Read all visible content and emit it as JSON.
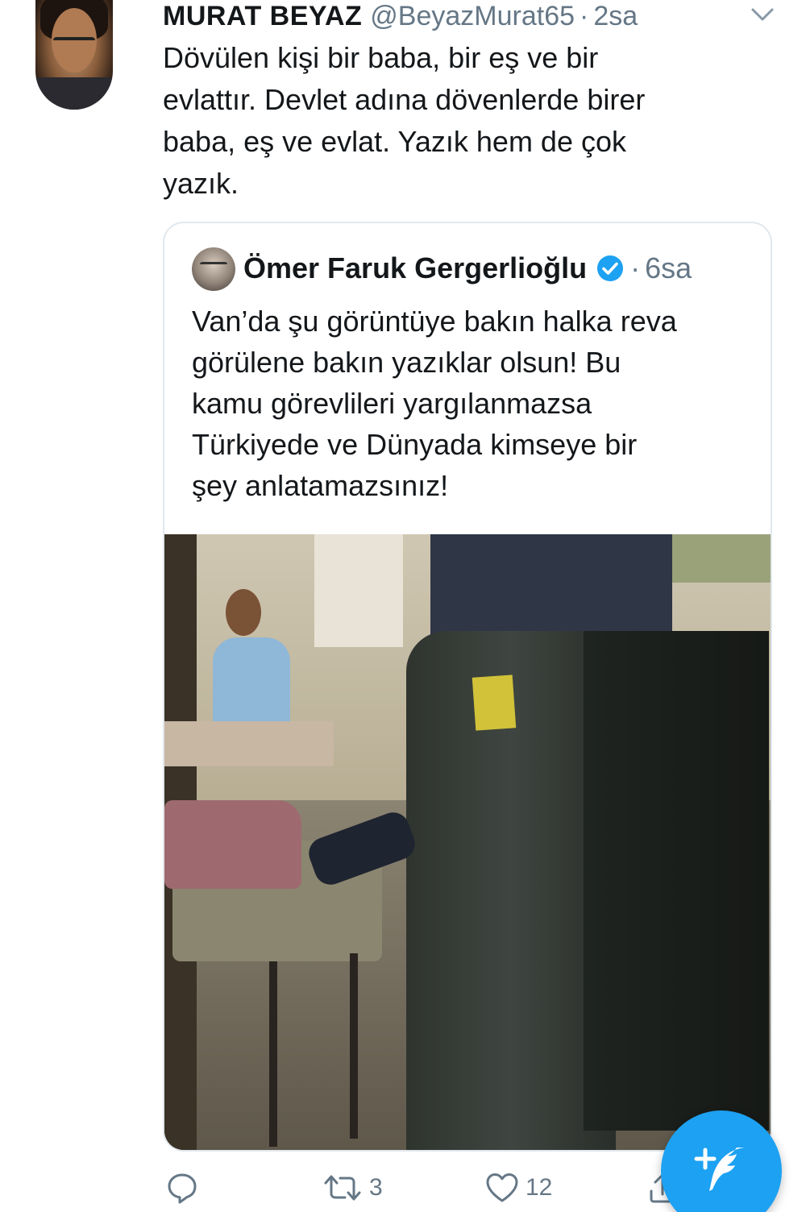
{
  "tweet": {
    "display_name": "MURAT BEYAZ",
    "handle": "@BeyazMurat65",
    "separator": "·",
    "time": "2sa",
    "avatar_icon": "user-avatar",
    "menu_icon": "chevron-down-icon",
    "text": "Dövülen kişi bir baba, bir eş ve bir\nevlattır. Devlet adına dövenlerde birer\nbaba, eş ve evlat. Yazık hem de çok\nyazık."
  },
  "quoted_tweet": {
    "display_name": "Ömer Faruk Gergerlioğlu",
    "verified": true,
    "separator": "·",
    "time": "6sa",
    "text": "Van’da şu görüntüye bakın halka reva\ngörülene bakın yazıklar olsun! Bu\nkamu görevlileri yargılanmazsa\nTürkiyede ve Dünyada kimseye bir\nşey anlatamazsınız!",
    "media_icon": "video-thumbnail"
  },
  "actions": {
    "reply_icon": "reply-icon",
    "retweet_icon": "retweet-icon",
    "retweet_count": "3",
    "like_icon": "heart-icon",
    "like_count": "12",
    "share_icon": "share-icon"
  },
  "compose": {
    "icon": "compose-tweet-icon"
  },
  "colors": {
    "accent": "#1DA1F2",
    "text": "#14171A",
    "secondary": "#657786",
    "border": "#E1E8ED"
  }
}
